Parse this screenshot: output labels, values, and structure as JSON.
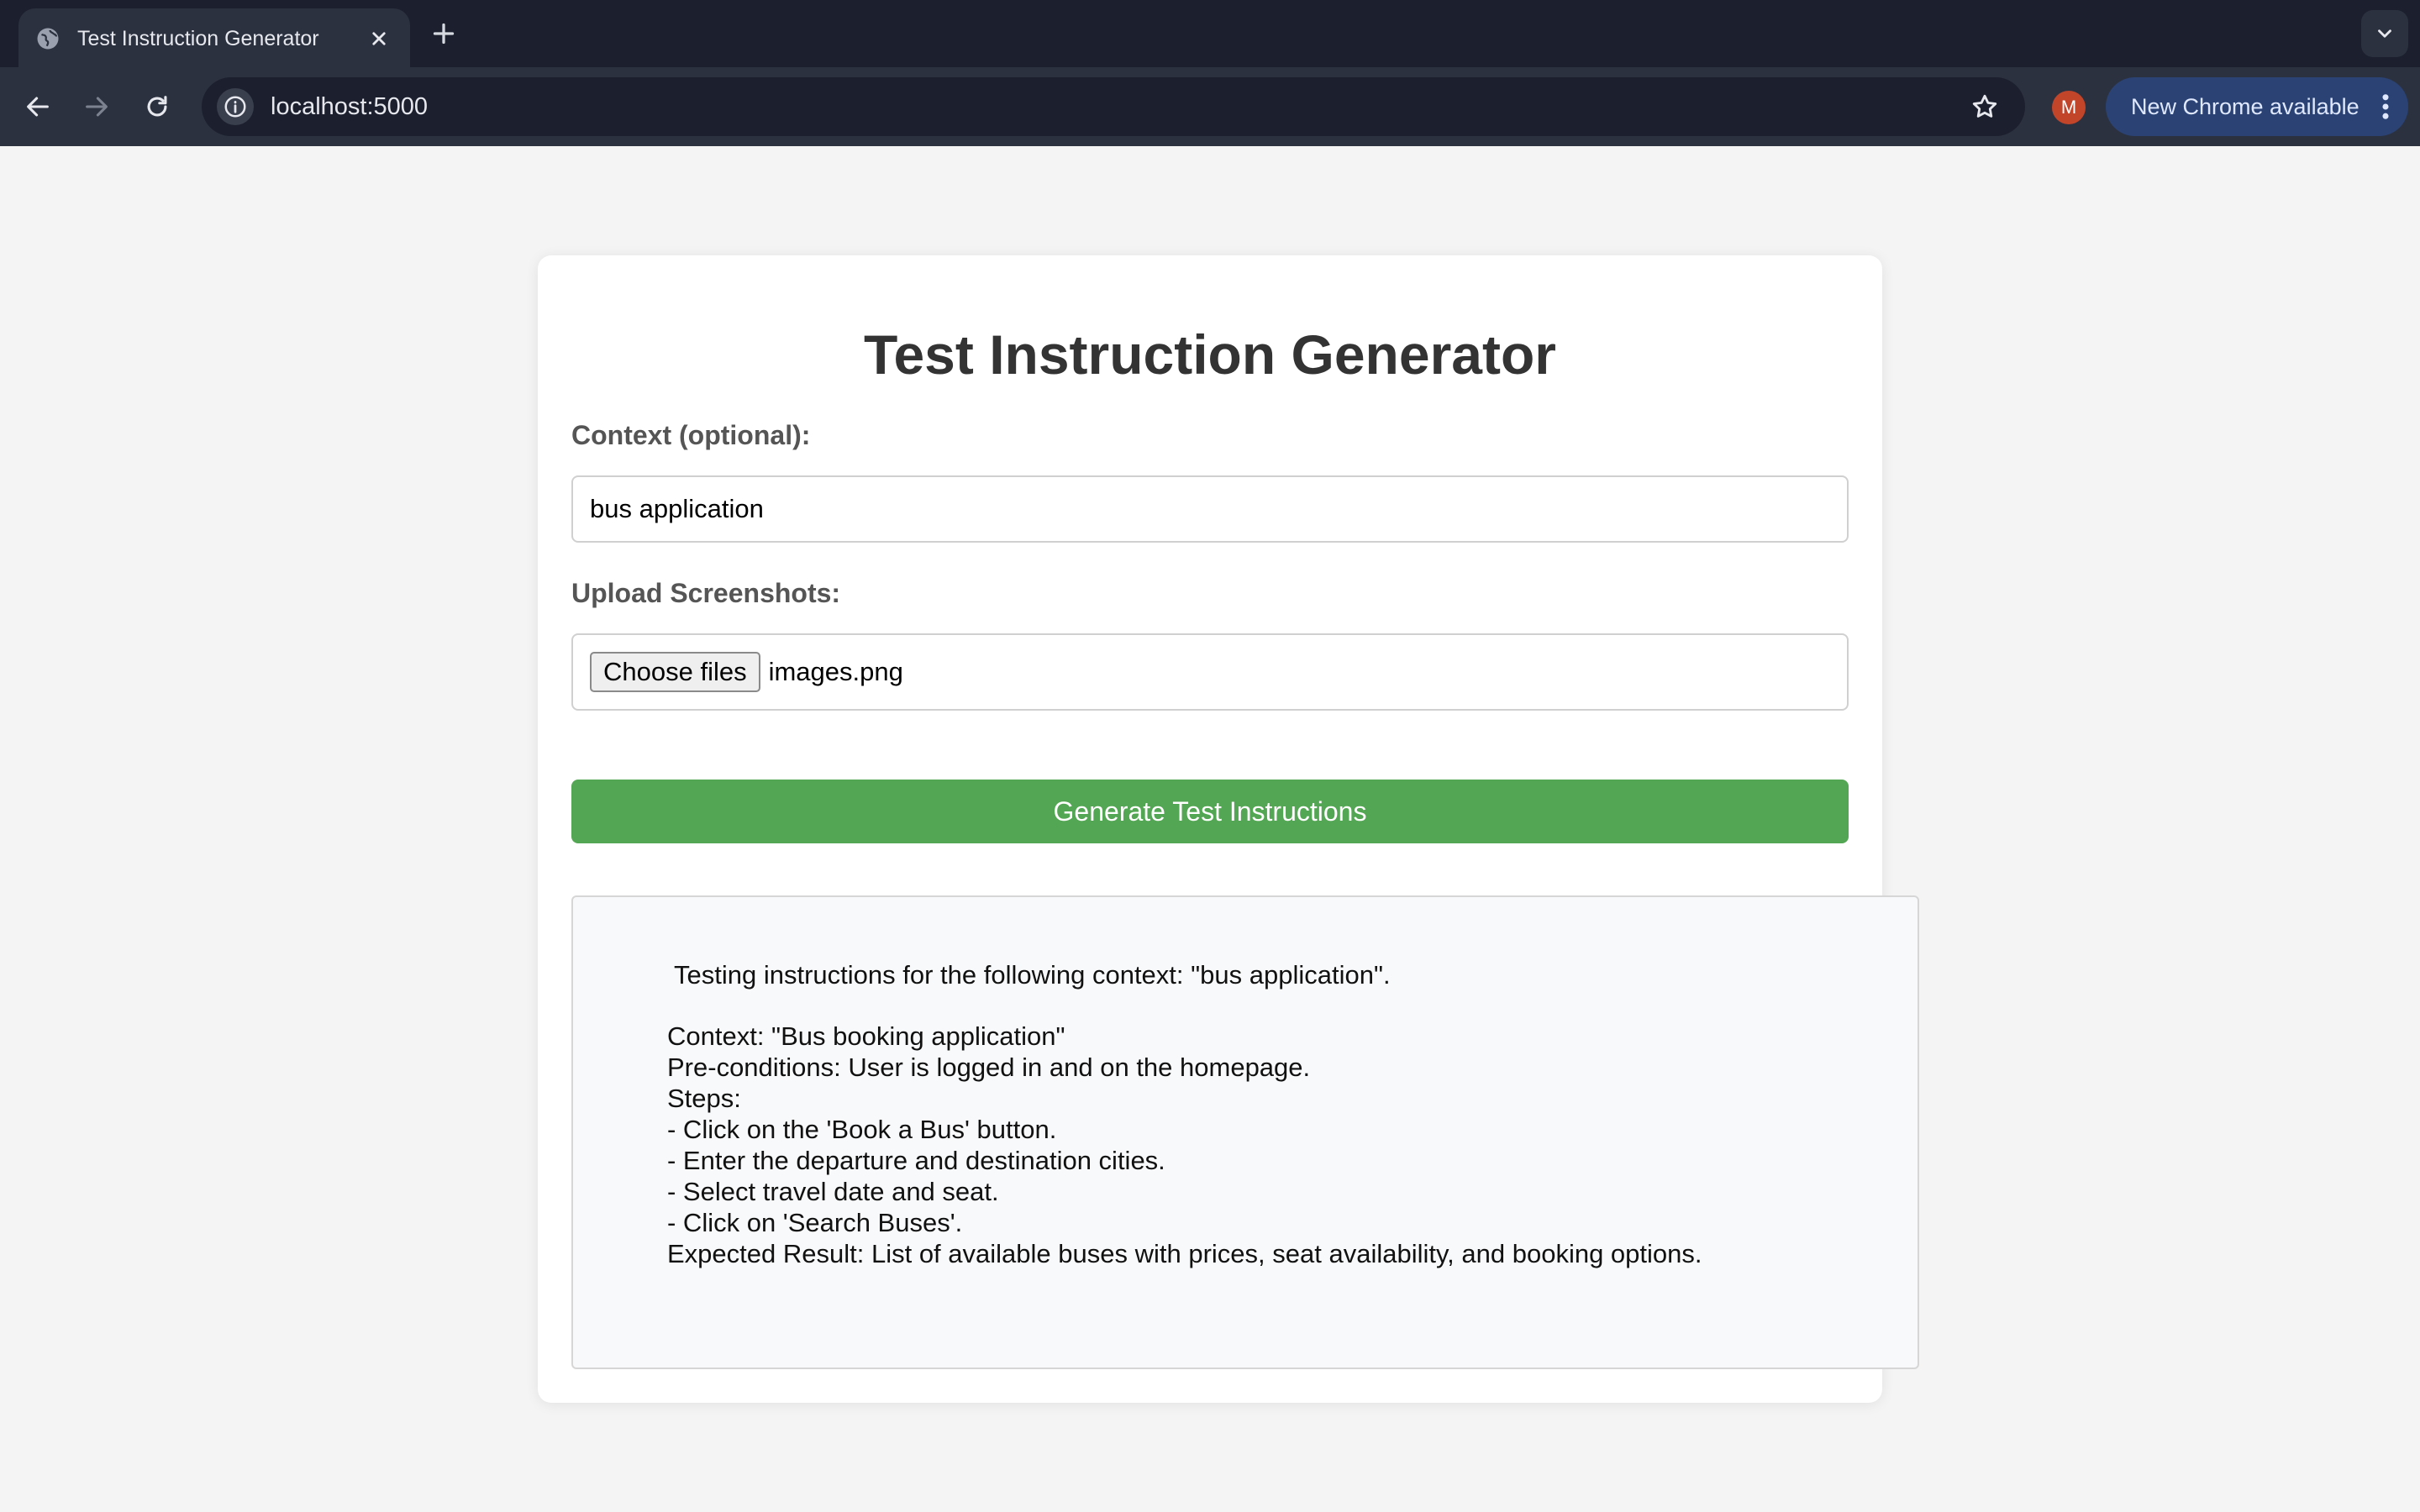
{
  "browser": {
    "tab_title": "Test Instruction Generator",
    "url": "localhost:5000",
    "profile_initial": "M",
    "update_label": "New Chrome available",
    "icons": [
      "globe-icon",
      "close-icon",
      "plus-icon",
      "chevron-down-icon",
      "back-arrow-icon",
      "forward-arrow-icon",
      "reload-icon",
      "info-icon",
      "star-icon",
      "more-vert-icon"
    ]
  },
  "page": {
    "title": "Test Instruction Generator",
    "context_label": "Context (optional):",
    "context_value": "bus application",
    "upload_label": "Upload Screenshots:",
    "file_button_label": "Choose files",
    "file_name": "images.png",
    "generate_label": "Generate Test Instructions",
    "accent_color": "#53a653"
  },
  "result": {
    "intro": "Testing instructions for the following context: \"bus application\".",
    "lines": [
      "Context: \"Bus booking application\"",
      "Pre-conditions: User is logged in and on the homepage.",
      "Steps:",
      "- Click on the 'Book a Bus' button.",
      "- Enter the departure and destination cities.",
      "- Select travel date and seat.",
      "- Click on 'Search Buses'.",
      "Expected Result: List of available buses with prices, seat availability, and booking options."
    ]
  }
}
